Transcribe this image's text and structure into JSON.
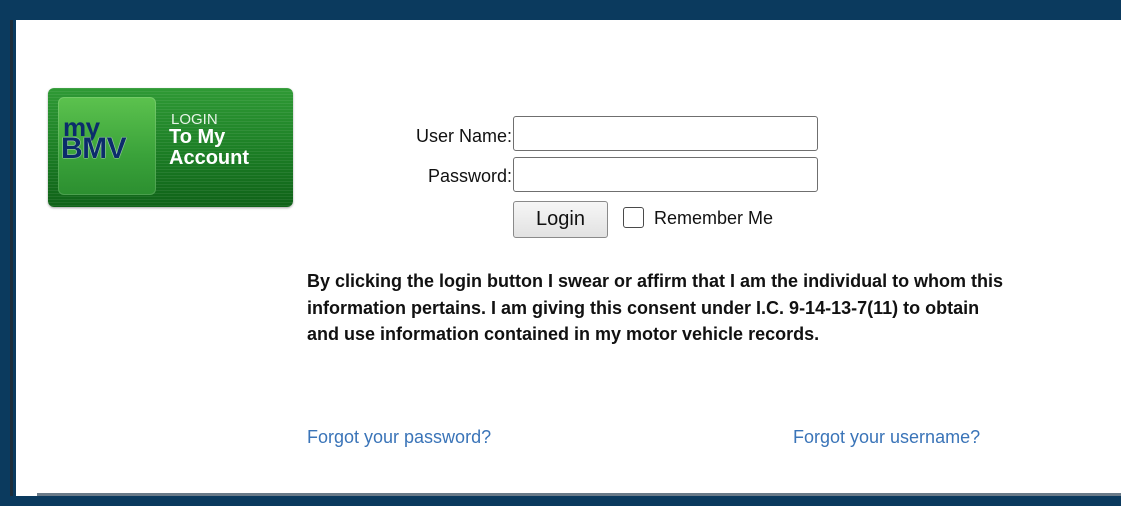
{
  "logo": {
    "my": "my",
    "bmv": "BMV",
    "line1": "LOGIN",
    "line2": "To My",
    "line3": "Account"
  },
  "form": {
    "username_label": "User Name:",
    "username_value": "",
    "password_label": "Password:",
    "password_value": "",
    "login_button": "Login",
    "remember_label": "Remember Me",
    "remember_checked": false
  },
  "consent_text": "By clicking the login button I swear or affirm that I am the individual to whom this information pertains. I am giving this consent under I.C. 9-14-13-7(11) to obtain and use information contained in my motor vehicle records.",
  "links": {
    "forgot_password": "Forgot your password?",
    "forgot_username": "Forgot your username?"
  },
  "colors": {
    "frame": "#0b3a5e",
    "logo_green": "#1b7d24",
    "logo_text_blue": "#0b2c6b",
    "link_blue": "#3a74b8"
  }
}
